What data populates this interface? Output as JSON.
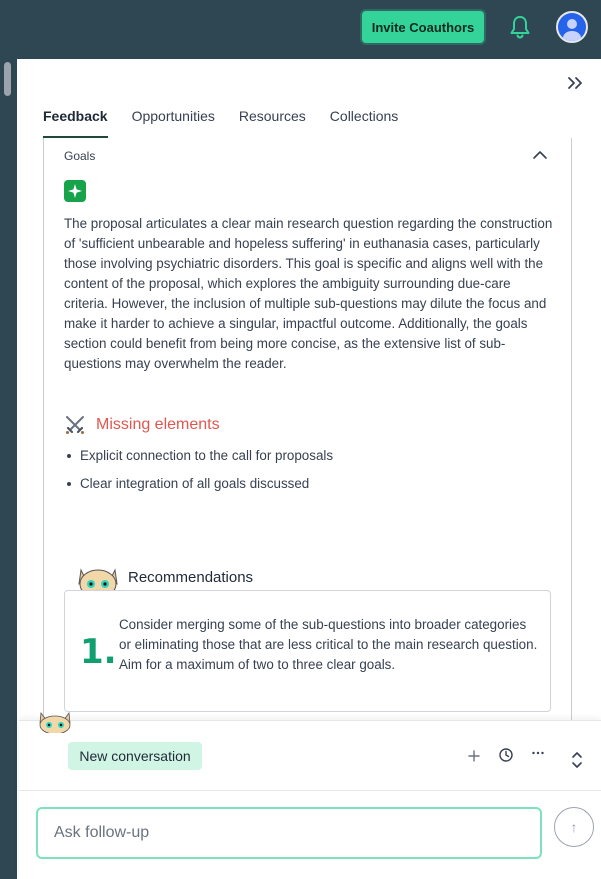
{
  "header": {
    "invite_label": "Invite Coauthors",
    "icons": [
      "bell-icon",
      "avatar"
    ]
  },
  "tabs": [
    {
      "label": "Feedback",
      "active": true
    },
    {
      "label": "Opportunities",
      "active": false
    },
    {
      "label": "Resources",
      "active": false
    },
    {
      "label": "Collections",
      "active": false
    }
  ],
  "goals": {
    "title": "Goals",
    "body": "The proposal articulates a clear main research question regarding the construction of 'sufficient unbearable and hopeless suffering' in euthanasia cases, particularly those involving psychiatric disorders. This goal is specific and aligns well with the content of the proposal, which explores the ambiguity surrounding due-care criteria. However, the inclusion of multiple sub-questions may dilute the focus and make it harder to achieve a singular, impactful outcome. Additionally, the goals section could benefit from being more concise, as the extensive list of sub-questions may overwhelm the reader.",
    "missing_title": "Missing elements",
    "missing_items": [
      "Explicit connection to the call for proposals",
      "Clear integration of all goals discussed"
    ],
    "recommendations_title": "Recommendations",
    "recommendation_number": "1.",
    "recommendation_text": "Consider merging some of the sub-questions into broader categories or eliminating those that are less critical to the main research question. Aim for a maximum of two to three clear goals."
  },
  "chat": {
    "new_conversation_label": "New conversation",
    "input_placeholder": "Ask follow-up",
    "send_symbol": "↑"
  },
  "colors": {
    "topbar": "#2f4653",
    "accent": "#34d399",
    "missing": "#e0574f",
    "number": "#10a070"
  }
}
